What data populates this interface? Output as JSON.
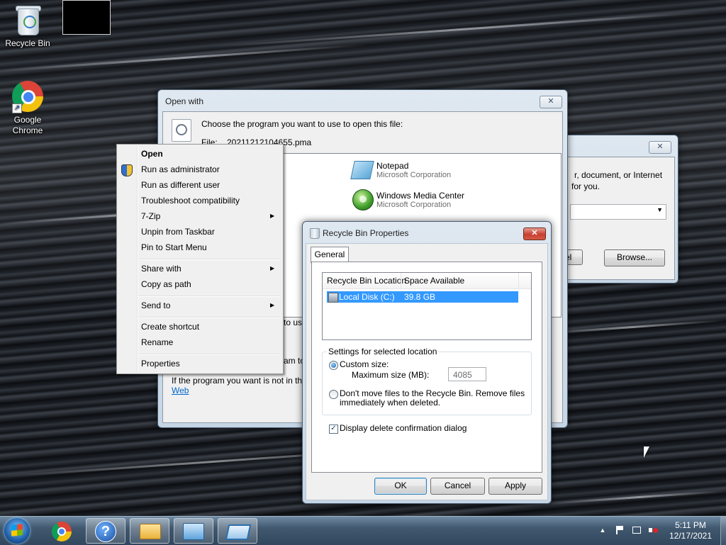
{
  "desktop": {
    "icons": [
      {
        "label": "Recycle Bin"
      },
      {
        "label": "Google Chrome"
      }
    ]
  },
  "open_with": {
    "title": "Open with",
    "close_glyph": "✕",
    "prompt": "Choose the program you want to use to open this file:",
    "file_label": "File:",
    "file_name": "20211212104655.pma",
    "programs": [
      {
        "name": "Notepad",
        "company": "Microsoft Corporation",
        "icon": "notepad-icon"
      },
      {
        "name": "Windows Media Center",
        "company": "Microsoft Corporation",
        "icon": "media-center-icon"
      }
    ],
    "checkbox_fragment": "to us",
    "desc_fragment": "am to",
    "not_in_list_text": "If the program you want is not in the li",
    "web_link": "Web"
  },
  "run_dialog": {
    "close_glyph": "✕",
    "desc_line1": "r, document, or Internet",
    "desc_line2": "for you.",
    "cancel_fragment": "cel",
    "browse_label": "Browse..."
  },
  "context_menu": {
    "items": [
      {
        "label": "Open",
        "bold": true
      },
      {
        "label": "Run as administrator",
        "icon": "shield-icon"
      },
      {
        "label": "Run as different user"
      },
      {
        "label": "Troubleshoot compatibility"
      },
      {
        "label": "7-Zip",
        "submenu": true
      },
      {
        "label": "Unpin from Taskbar"
      },
      {
        "label": "Pin to Start Menu"
      },
      {
        "label": "Share with",
        "submenu": true
      },
      {
        "label": "Copy as path"
      },
      {
        "label": "Send to",
        "submenu": true
      },
      {
        "label": "Create shortcut"
      },
      {
        "label": "Rename"
      },
      {
        "label": "Properties"
      }
    ],
    "submenu_arrow": "▶"
  },
  "recycle_props": {
    "title": "Recycle Bin Properties",
    "close_glyph": "✕",
    "tab_general": "General",
    "columns": [
      "Recycle Bin Location",
      "Space Available"
    ],
    "rows": [
      {
        "location": "Local Disk (C:)",
        "space": "39.8 GB",
        "selected": true
      }
    ],
    "group_title": "Settings for selected location",
    "custom_size_label": "Custom size:",
    "custom_size_selected": true,
    "max_size_label": "Maximum size (MB):",
    "max_size_value": "4085",
    "dont_move_label_1": "Don't move files to the Recycle Bin. Remove files",
    "dont_move_label_2": "immediately when deleted.",
    "display_confirm_label": "Display delete confirmation dialog",
    "display_confirm_checked": true,
    "check_glyph": "✓",
    "ok_label": "OK",
    "cancel_label": "Cancel",
    "apply_label": "Apply"
  },
  "taskbar": {
    "items": [
      "start-button",
      "chrome",
      "help",
      "file-explorer",
      "control-panel",
      "remote-desktop"
    ],
    "clock_time": "5:11 PM",
    "clock_date": "12/17/2021",
    "tray_expand": "▲"
  }
}
